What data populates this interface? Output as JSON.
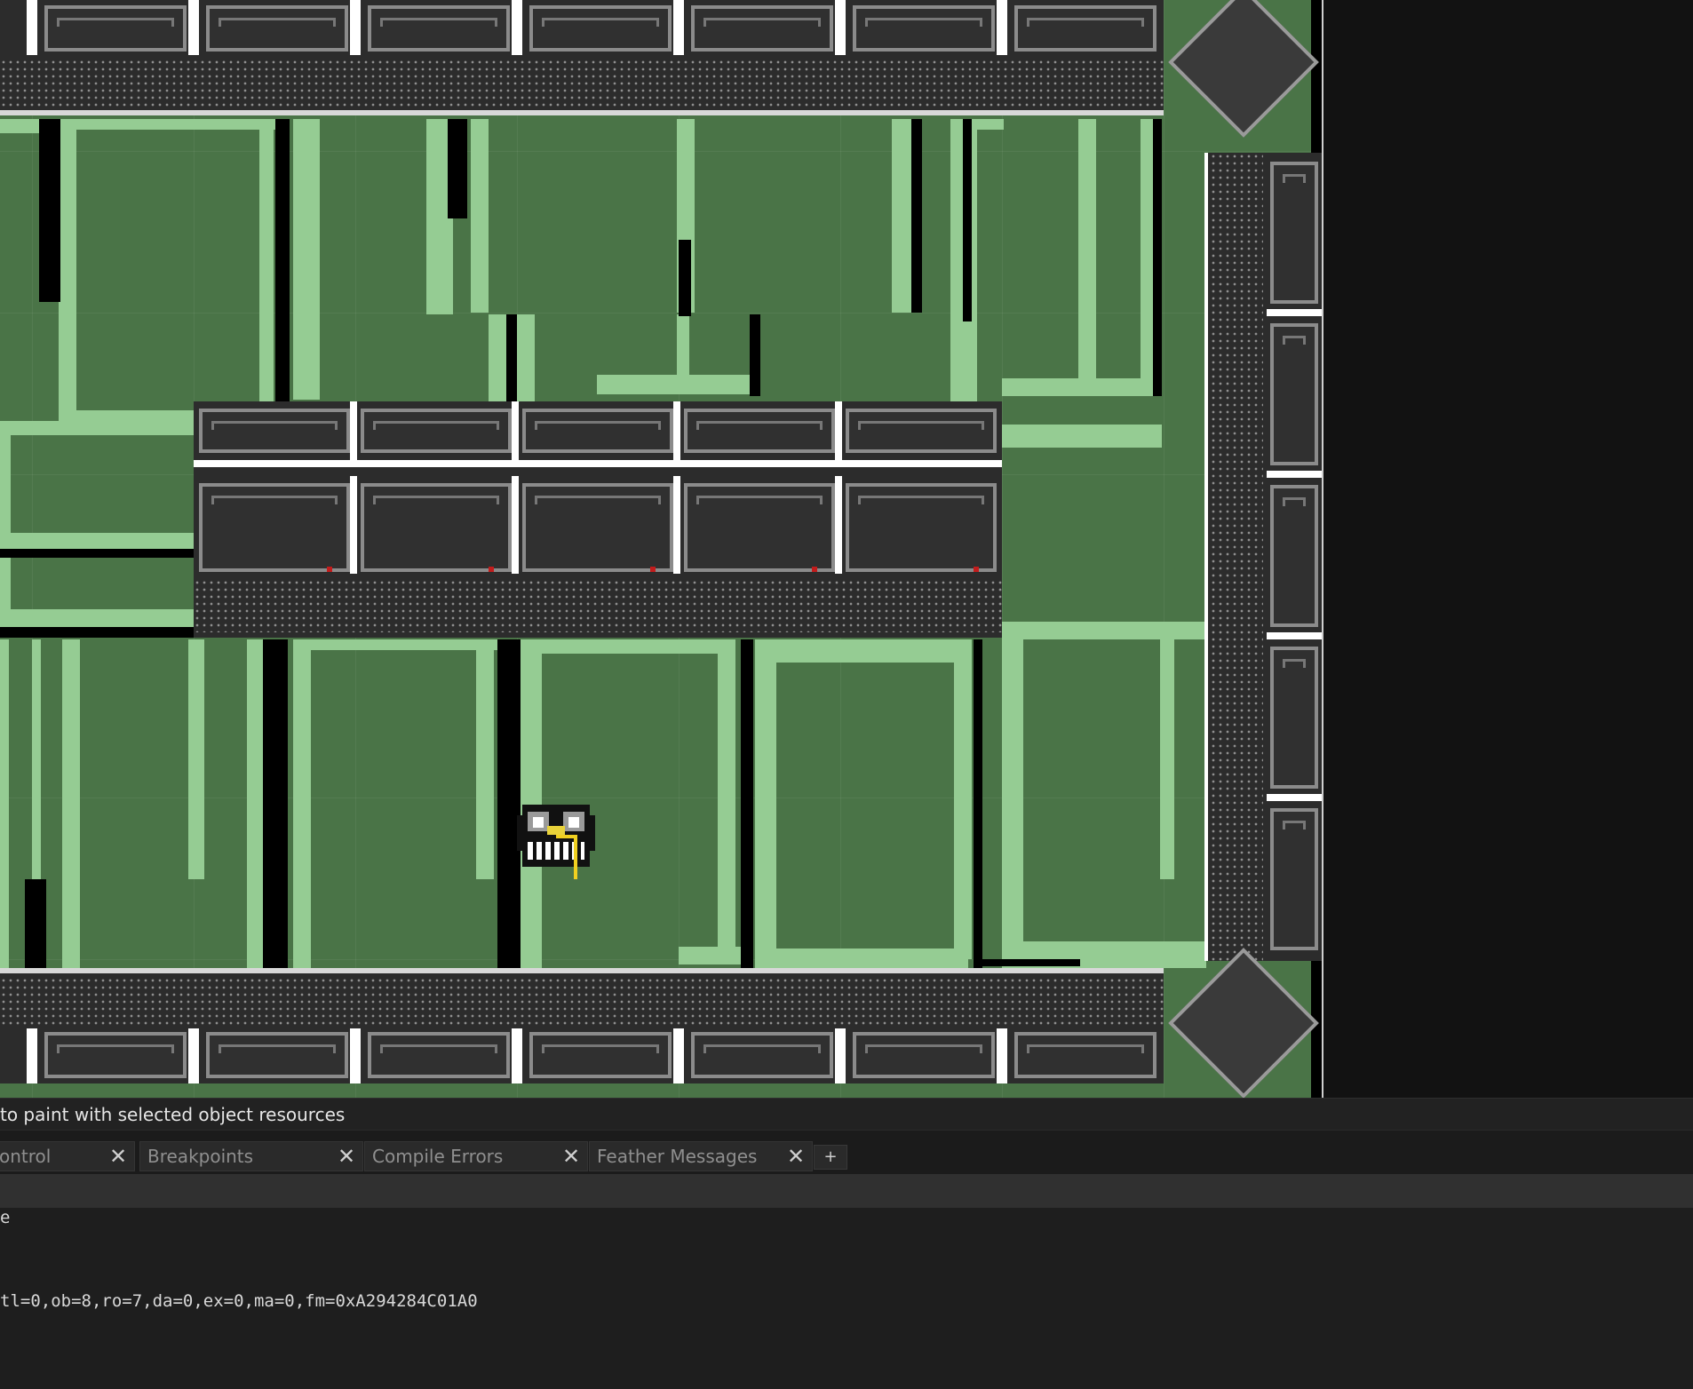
{
  "status_bar": {
    "hint": "to paint with selected object resources"
  },
  "tabs": [
    {
      "label": "ontrol",
      "close": "✕"
    },
    {
      "label": "Breakpoints",
      "close": "✕"
    },
    {
      "label": "Compile Errors",
      "close": "✕"
    },
    {
      "label": "Feather Messages",
      "close": "✕"
    }
  ],
  "tab_add_label": "+",
  "output": {
    "lines": [
      "e",
      "",
      "",
      "tl=0,ob=8,ro=7,da=0,ex=0,ma=0,fm=0xA294284C01A0"
    ]
  },
  "colors": {
    "floor": "#4a7447",
    "floor_light": "#95cc93",
    "wall": "#2c2c2c",
    "accent_red": "#c21c1c",
    "editor_bg": "#1e1e1e"
  },
  "icons": {
    "tab_close": "close-icon",
    "tab_add": "plus-icon",
    "player": "player-sprite"
  }
}
